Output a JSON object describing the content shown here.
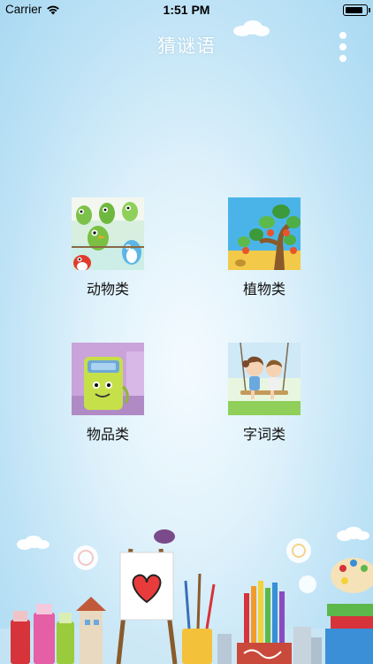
{
  "status_bar": {
    "carrier": "Carrier",
    "time": "1:51 PM"
  },
  "nav": {
    "title": "猜谜语"
  },
  "categories": [
    {
      "label": "动物类"
    },
    {
      "label": "植物类"
    },
    {
      "label": "物品类"
    },
    {
      "label": "字词类"
    }
  ],
  "colors": {
    "background_top": "#a9d9f2",
    "background_center": "#f4fbff",
    "title_text": "#ffffff",
    "label_text": "#111111"
  },
  "icons": [
    "wifi-icon",
    "battery-icon",
    "more-dots-icon"
  ]
}
